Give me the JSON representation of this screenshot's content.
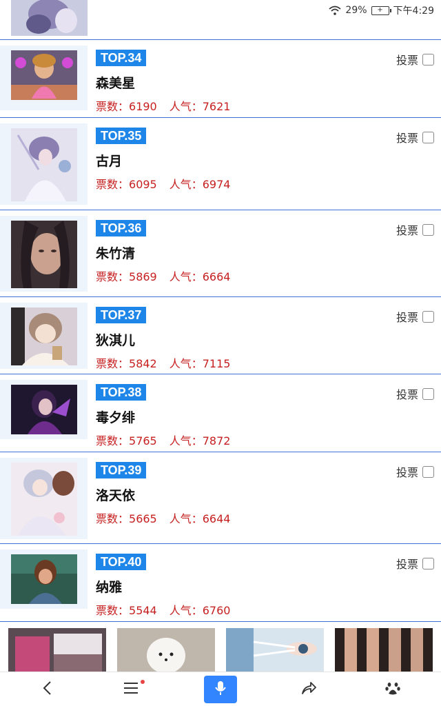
{
  "status_bar": {
    "battery_percent": "29%",
    "time": "下午4:29"
  },
  "vote_label": "投票",
  "stats_labels": {
    "votes": "票数：",
    "popularity": "人气："
  },
  "items": [
    {
      "rank": "TOP.34",
      "name": "森美星",
      "votes": "6190",
      "popularity": "7621"
    },
    {
      "rank": "TOP.35",
      "name": "古月",
      "votes": "6095",
      "popularity": "6974"
    },
    {
      "rank": "TOP.36",
      "name": "朱竹清",
      "votes": "5869",
      "popularity": "6664"
    },
    {
      "rank": "TOP.37",
      "name": "狄淇儿",
      "votes": "5842",
      "popularity": "7115"
    },
    {
      "rank": "TOP.38",
      "name": "毒夕绯",
      "votes": "5765",
      "popularity": "7872"
    },
    {
      "rank": "TOP.39",
      "name": "洛天依",
      "votes": "5665",
      "popularity": "6644"
    },
    {
      "rank": "TOP.40",
      "name": "纳雅",
      "votes": "5544",
      "popularity": "6760"
    }
  ],
  "icons": {
    "wifi": "wifi-icon",
    "battery": "battery-icon",
    "back": "back-arrow-icon",
    "menu": "menu-icon",
    "mic": "microphone-icon",
    "share": "share-icon",
    "home": "paw-icon"
  },
  "colors": {
    "badge": "#1e86e8",
    "stats": "#c62020",
    "divider": "#3f6fd8",
    "mic_button": "#3385ff"
  }
}
